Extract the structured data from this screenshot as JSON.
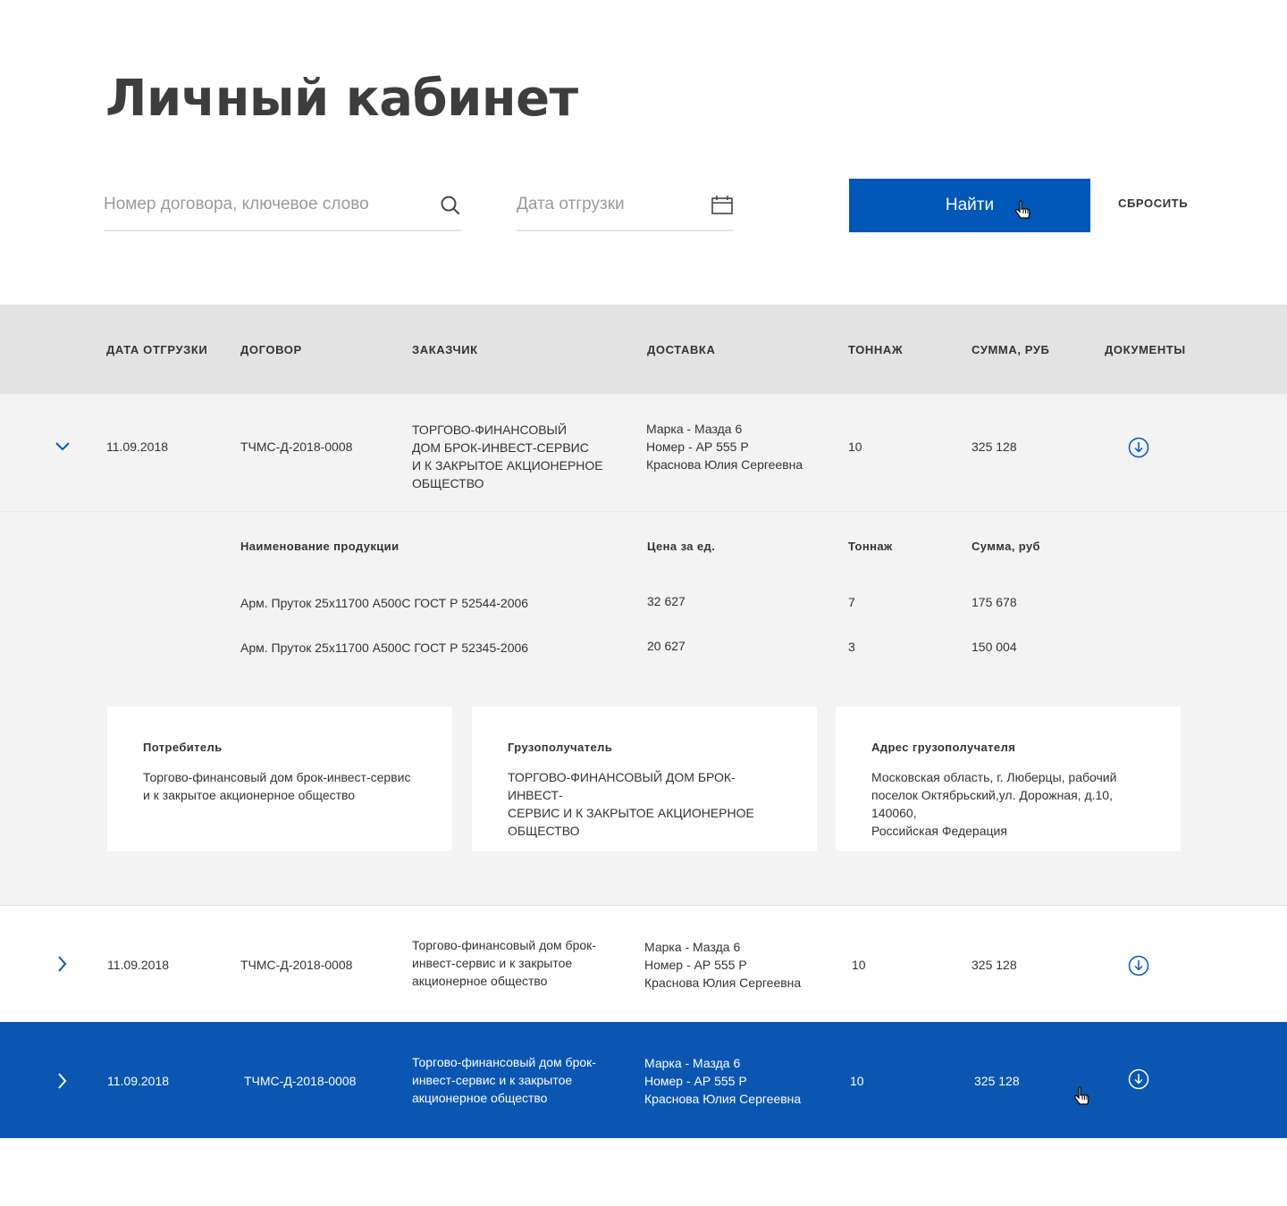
{
  "page": {
    "title": "Личный кабинет"
  },
  "filters": {
    "search_placeholder": "Номер договора, ключевое слово",
    "date_placeholder": "Дата отгрузки",
    "find_label": "Найти",
    "reset_label": "СБРОСИТЬ"
  },
  "colors": {
    "accent": "#0057b8",
    "selected_row": "#0a56b1",
    "header_bg": "#e3e3e3",
    "row_bg": "#f3f3f3"
  },
  "table": {
    "headers": [
      "ДАТА ОТГРУЗКИ",
      "ДОГОВОР",
      "ЗАКАЗЧИК",
      "ДОСТАВКА",
      "ТОННАЖ",
      "СУММА, РУБ",
      "ДОКУМЕНТЫ"
    ],
    "rows": [
      {
        "date": "11.09.2018",
        "contract": "ТЧМС-Д-2018-0008",
        "customer": "ТОРГОВО-ФИНАНСОВЫЙ\nДОМ БРОК-ИНВЕСТ-СЕРВИС\nИ К ЗАКРЫТОЕ АКЦИОНЕРНОЕ\nОБЩЕСТВО",
        "delivery": "Марка - Мазда 6\nНомер - АР 555 Р\nКраснова Юлия Сергеевна",
        "tonnage": "10",
        "sum": "325 128",
        "expanded": true
      },
      {
        "date": "11.09.2018",
        "contract": "ТЧМС-Д-2018-0008",
        "customer": "Торгово-финансовый дом брок-\nинвест-сервис и к закрытое\nакционерное общество",
        "delivery": "Марка - Мазда 6\nНомер - АР 555 Р\nКраснова Юлия Сергеевна",
        "tonnage": "10",
        "sum": "325 128",
        "expanded": false
      },
      {
        "date": "11.09.2018",
        "contract": "ТЧМС-Д-2018-0008",
        "customer": "Торгово-финансовый дом брок-\nинвест-сервис и к закрытое\nакционерное общество",
        "delivery": "Марка - Мазда 6\nНомер - АР 555 Р\nКраснова Юлия Сергеевна",
        "tonnage": "10",
        "sum": "325 128",
        "expanded": false,
        "selected": true
      }
    ]
  },
  "details": {
    "headers": [
      "Наименование продукции",
      "Цена за ед.",
      "Тоннаж",
      "Сумма, руб"
    ],
    "products": [
      {
        "name": "Арм. Пруток 25х11700 А500С ГОСТ Р 52544-2006",
        "price": "32 627",
        "tonnage": "7",
        "sum": "175 678"
      },
      {
        "name": "Арм. Пруток 25х11700 А500С ГОСТ Р 52345-2006",
        "price": "20 627",
        "tonnage": "3",
        "sum": "150 004"
      }
    ],
    "cards": [
      {
        "title": "Потребитель",
        "text": "Торгово-финансовый дом брок-инвест-сервис\nи к закрытое акционерное общество"
      },
      {
        "title": "Грузополучатель",
        "text": "ТОРГОВО-ФИНАНСОВЫЙ ДОМ БРОК-ИНВЕСТ-\nСЕРВИС И К ЗАКРЫТОЕ АКЦИОНЕРНОЕ\nОБЩЕСТВО"
      },
      {
        "title": "Адрес грузополучателя",
        "text": "Московская область, г. Люберцы, рабочий\nпоселок Октябрьский,ул. Дорожная, д.10, 140060,\nРоссийская Федерация"
      }
    ]
  },
  "icons": {
    "search": "search-icon",
    "calendar": "calendar-icon",
    "expand": "chevron-down-icon",
    "collapse": "chevron-right-icon",
    "download": "download-icon",
    "cursor": "hand-cursor-icon"
  }
}
